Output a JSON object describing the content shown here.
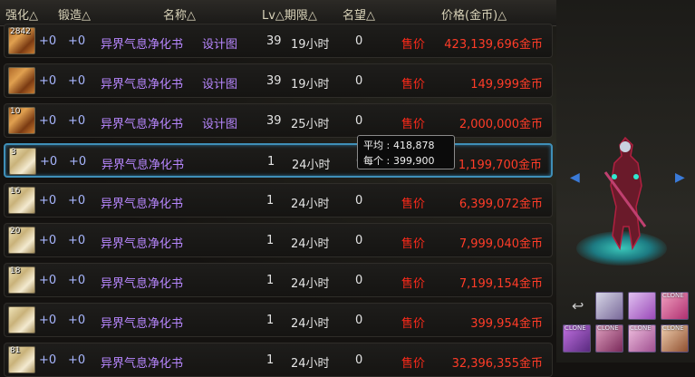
{
  "columns": {
    "enhance": "强化△",
    "forge": "锻造△",
    "name": "名称△",
    "lv_period": "Lv△期限△",
    "fame": "名望△",
    "price": "价格(金币)△"
  },
  "rows": [
    {
      "icon": "recipe-scroll-icon",
      "count": "2842",
      "enhance": "+0",
      "forge": "+0",
      "name": "异界气息净化书",
      "extra": "设计图",
      "lv": "39",
      "period": "19小时",
      "fame": "0",
      "tag": "售价",
      "price": "423,139,696金币"
    },
    {
      "icon": "recipe-scroll-icon",
      "count": "",
      "enhance": "+0",
      "forge": "+0",
      "name": "异界气息净化书",
      "extra": "设计图",
      "lv": "39",
      "period": "19小时",
      "fame": "0",
      "tag": "售价",
      "price": "149,999金币"
    },
    {
      "icon": "recipe-scroll-icon",
      "count": "10",
      "enhance": "+0",
      "forge": "+0",
      "name": "异界气息净化书",
      "extra": "设计图",
      "lv": "39",
      "period": "25小时",
      "fame": "0",
      "tag": "售价",
      "price": "2,000,000金币"
    },
    {
      "icon": "scroll-icon",
      "count": "3",
      "enhance": "+0",
      "forge": "+0",
      "name": "异界气息净化书",
      "extra": "",
      "lv": "1",
      "period": "24小时",
      "fame": "0",
      "tag": "",
      "price": "1,199,700金币"
    },
    {
      "icon": "scroll-icon",
      "count": "16",
      "enhance": "+0",
      "forge": "+0",
      "name": "异界气息净化书",
      "extra": "",
      "lv": "1",
      "period": "24小时",
      "fame": "0",
      "tag": "售价",
      "price": "6,399,072金币"
    },
    {
      "icon": "scroll-icon",
      "count": "20",
      "enhance": "+0",
      "forge": "+0",
      "name": "异界气息净化书",
      "extra": "",
      "lv": "1",
      "period": "24小时",
      "fame": "0",
      "tag": "售价",
      "price": "7,999,040金币"
    },
    {
      "icon": "scroll-icon",
      "count": "18",
      "enhance": "+0",
      "forge": "+0",
      "name": "异界气息净化书",
      "extra": "",
      "lv": "1",
      "period": "24小时",
      "fame": "0",
      "tag": "售价",
      "price": "7,199,154金币"
    },
    {
      "icon": "scroll-icon",
      "count": "",
      "enhance": "+0",
      "forge": "+0",
      "name": "异界气息净化书",
      "extra": "",
      "lv": "1",
      "period": "24小时",
      "fame": "0",
      "tag": "售价",
      "price": "399,954金币"
    },
    {
      "icon": "scroll-icon",
      "count": "81",
      "enhance": "+0",
      "forge": "+0",
      "name": "异界气息净化书",
      "extra": "",
      "lv": "1",
      "period": "24小时",
      "fame": "0",
      "tag": "售价",
      "price": "32,396,355金币"
    }
  ],
  "tooltip": {
    "avg_label": "平均 :",
    "avg_value": "418,878",
    "each_label": "每个 :",
    "each_value": "399,900"
  },
  "side": {
    "left_arrow": "◀",
    "right_arrow": "▶",
    "back": "↩",
    "slots": [
      "CLONE",
      "CLONE",
      "CLONE",
      "CLONE",
      "CLONE"
    ]
  },
  "colors": {
    "selected_border": "#3f8fb8",
    "price": "#ff3c28",
    "name": "#b887ff"
  }
}
